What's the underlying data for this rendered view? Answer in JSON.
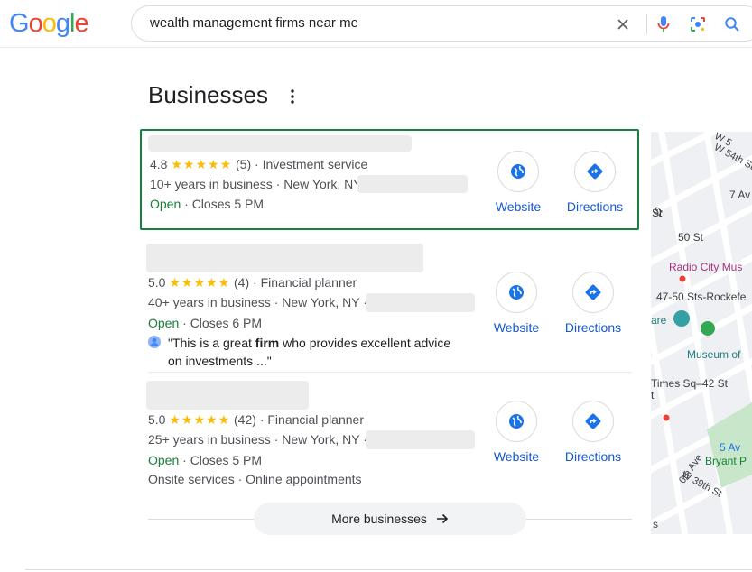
{
  "header": {
    "logo_letters": [
      "G",
      "o",
      "o",
      "g",
      "l",
      "e"
    ],
    "logo_colors": [
      "#4285f4",
      "#ea4335",
      "#fbbc05",
      "#4285f4",
      "#34a853",
      "#ea4335"
    ],
    "search_value": "wealth management firms near me",
    "icons": [
      "close-icon",
      "mic-icon",
      "lens-icon",
      "search-icon"
    ]
  },
  "section": {
    "title": "Businesses"
  },
  "businesses": [
    {
      "rating": "4.8",
      "stars": "★★★★★",
      "reviews": "(5)",
      "category": "· Investment service",
      "years": "10+ years in business · New York, NY",
      "status": "Open",
      "hours": "· Closes 5 PM",
      "website_label": "Website",
      "directions_label": "Directions"
    },
    {
      "rating": "5.0",
      "stars": "★★★★★",
      "reviews": "(4)",
      "category": "· Financial planner",
      "years": "40+ years in business · New York, NY ·",
      "status": "Open",
      "hours": "· Closes 6 PM",
      "review_pre": "\"This is a great ",
      "review_bold": "firm",
      "review_post": " who provides excellent advice",
      "review_line2": "on investments ...\"",
      "website_label": "Website",
      "directions_label": "Directions"
    },
    {
      "rating": "5.0",
      "stars": "★★★★★",
      "reviews": "(42)",
      "category": "· Financial planner",
      "years": "25+ years in business · New York, NY ·",
      "status": "Open",
      "hours": "· Closes 5 PM",
      "services": "Onsite services · Online appointments",
      "website_label": "Website",
      "directions_label": "Directions"
    }
  ],
  "more_button": "More businesses",
  "map": {
    "labels": [
      "W 5",
      "W 54th St",
      "St",
      "7 Av",
      "St",
      "50 St",
      "Radio City Mus",
      "47-50 Sts-Rockefe",
      "are",
      "Museum of",
      "Times Sq–42 St",
      "t",
      "5 Av",
      "Bryant P",
      "6th Ave",
      "W 39th St",
      "s"
    ]
  }
}
